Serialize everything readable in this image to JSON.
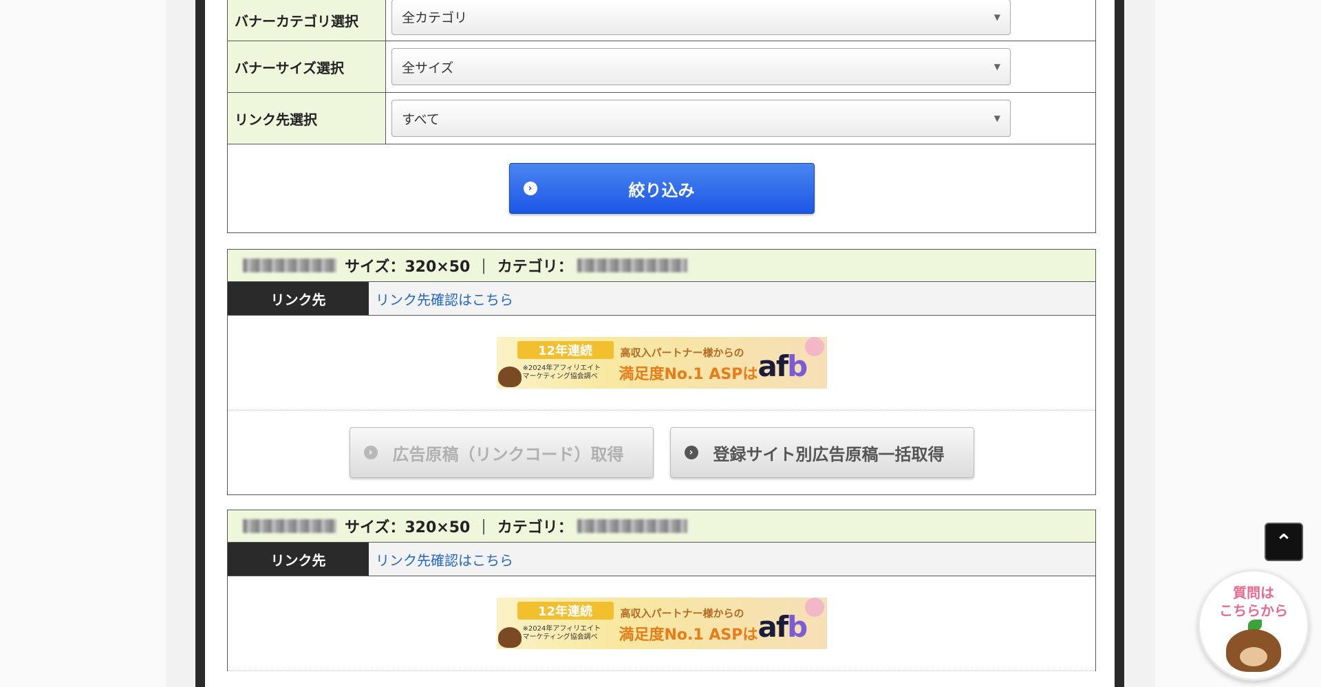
{
  "filters": {
    "category": {
      "label": "バナーカテゴリ選択",
      "value": "全カテゴリ"
    },
    "size": {
      "label": "バナーサイズ選択",
      "value": "全サイズ"
    },
    "link": {
      "label": "リンク先選択",
      "value": "すべて"
    },
    "submit_label": "絞り込み"
  },
  "banners": [
    {
      "size_text": "サイズ：320×50",
      "separator": "|",
      "category_text": "カテゴリ：",
      "link_label": "リンク先",
      "link_text": "リンク先確認はこちら",
      "ad": {
        "badge": "12年連続",
        "note": "※2024年アフィリエイトマーケティング協会調べ",
        "headline_small": "高収入パートナー様からの",
        "headline": "満足度No.1 ASPは",
        "logo_a": "af",
        "logo_b": "b"
      },
      "btn_code": "広告原稿（リンクコード）取得",
      "btn_bulk": "登録サイト別広告原稿一括取得"
    },
    {
      "size_text": "サイズ：320×50",
      "separator": "|",
      "category_text": "カテゴリ：",
      "link_label": "リンク先",
      "link_text": "リンク先確認はこちら",
      "ad": {
        "badge": "12年連続",
        "note": "※2024年アフィリエイトマーケティング協会調べ",
        "headline_small": "高収入パートナー様からの",
        "headline": "満足度No.1 ASPは",
        "logo_a": "af",
        "logo_b": "b"
      }
    }
  ],
  "help": {
    "text_line1": "質問は",
    "text_line2": "こちらから"
  },
  "icons": {
    "select_arrow": "▼",
    "circle_arrow": "›",
    "pagetop": "⌃"
  }
}
